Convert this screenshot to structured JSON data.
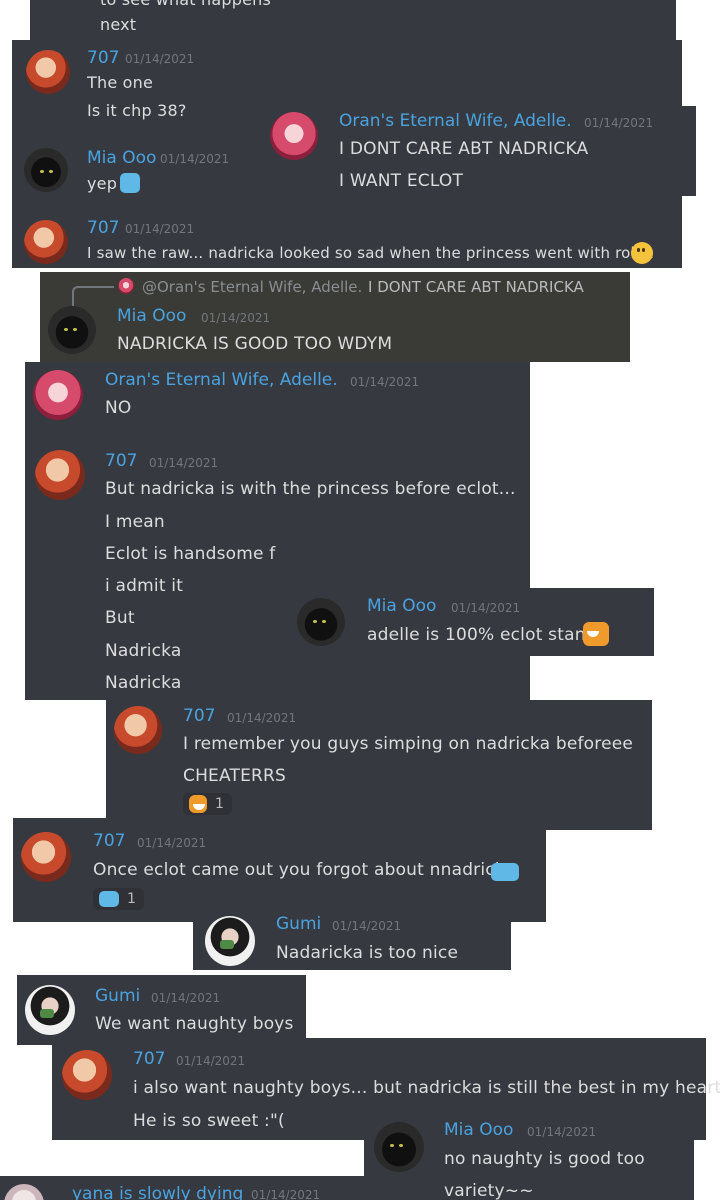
{
  "snips": [
    {
      "lines": [
        "to see what happens",
        "next"
      ]
    },
    {
      "user": "707",
      "time": "01/14/2021",
      "lines": [
        "The one",
        "Is it chp 38?"
      ]
    },
    {
      "user": "Oran's Eternal Wife, Adelle.",
      "time": "01/14/2021",
      "lines": [
        "I DONT CARE ABT NADRICKA",
        "I WANT ECLOT"
      ]
    },
    {
      "user": "Mia Ooo",
      "time": "01/14/2021",
      "lines": [
        "yep"
      ]
    },
    {
      "user": "707",
      "time": "01/14/2021",
      "lines": [
        "I saw the raw... nadricka looked so sad when the princess went with robia"
      ]
    },
    {
      "reply_to": "@Oran's Eternal Wife, Adelle.",
      "reply_text": "I DONT CARE ABT NADRICKA",
      "user": "Mia Ooo",
      "time": "01/14/2021",
      "lines": [
        "NADRICKA IS  GOOD  TOO WDYM"
      ]
    },
    {
      "user": "Oran's Eternal Wife, Adelle.",
      "time": "01/14/2021",
      "lines": [
        "NO"
      ]
    },
    {
      "user": "707",
      "time": "01/14/2021",
      "lines": [
        "But nadricka is with the princess before eclot...",
        "I mean",
        "Eclot is handsome f",
        "i admit it",
        "But",
        "Nadricka",
        "Nadricka"
      ]
    },
    {
      "user": "Mia Ooo",
      "time": "01/14/2021",
      "lines": [
        "adelle is 100% eclot stan"
      ]
    },
    {
      "user": "707",
      "time": "01/14/2021",
      "lines": [
        "I remember you guys simping on nadricka beforeee",
        "CHEATERRS"
      ],
      "reaction_count": "1"
    },
    {
      "user": "707",
      "time": "01/14/2021",
      "lines": [
        "Once eclot came out you forgot about nnadricka"
      ],
      "reaction_count": "1"
    },
    {
      "user": "Gumi",
      "time": "01/14/2021",
      "lines": [
        "Nadaricka is too nice"
      ]
    },
    {
      "user": "Gumi",
      "time": "01/14/2021",
      "lines": [
        "We want naughty boys"
      ]
    },
    {
      "user": "707",
      "time": "01/14/2021",
      "lines": [
        "i also want naughty boys... but nadricka is still the best in my heart",
        "He is so sweet :\"("
      ]
    },
    {
      "user": "Mia Ooo",
      "time": "01/14/2021",
      "lines": [
        "no naughty is good too",
        "variety~~"
      ]
    },
    {
      "user": "yana is slowly dying",
      "time": "01/14/2021",
      "lines": []
    }
  ],
  "colors": {
    "bg": "#36393f",
    "name_707": "#4aa3e0",
    "name_mia": "#4aa3e0",
    "name_adelle": "#4aa3e0",
    "name_gumi": "#4aa3e0",
    "text": "#dcddde",
    "timestamp": "#72767d"
  },
  "icons": {
    "sad": "slightly-frowning-face-icon",
    "pepe": "laughing-pepe-icon",
    "blue": "blue-emote-icon"
  }
}
